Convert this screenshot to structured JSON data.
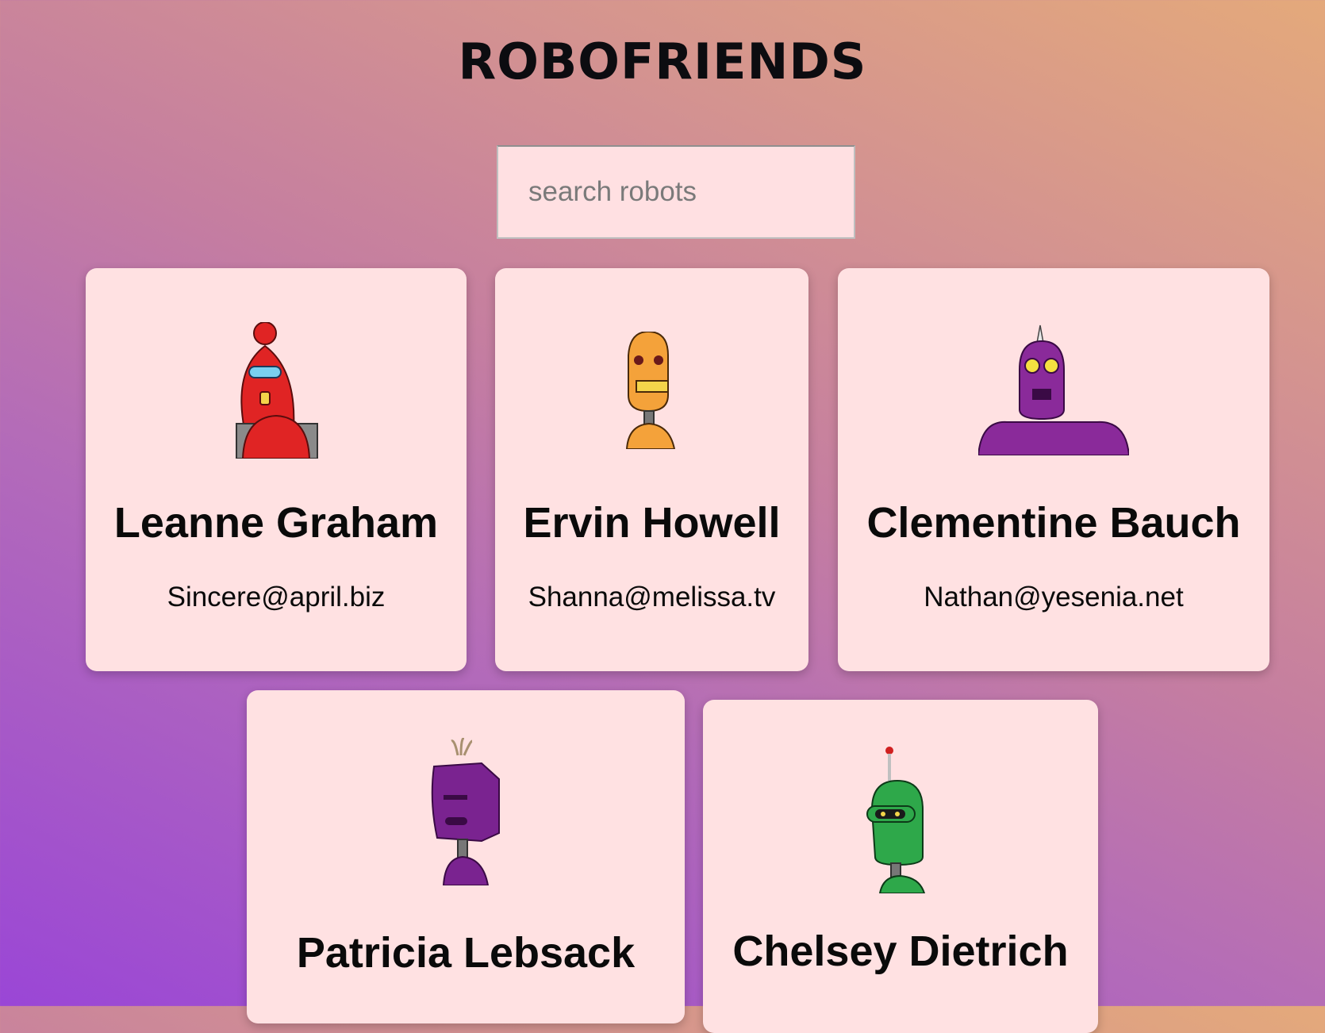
{
  "header": {
    "title": "ROBOFRIENDS"
  },
  "search": {
    "placeholder": "search robots",
    "value": ""
  },
  "robots": [
    {
      "name": "Leanne Graham",
      "email": "Sincere@april.biz",
      "icon": "red-robot-icon",
      "color": "#e02424"
    },
    {
      "name": "Ervin Howell",
      "email": "Shanna@melissa.tv",
      "icon": "orange-robot-icon",
      "color": "#f4a23a"
    },
    {
      "name": "Clementine Bauch",
      "email": "Nathan@yesenia.net",
      "icon": "purple-robot-icon",
      "color": "#8a2a9a"
    },
    {
      "name": "Patricia Lebsack",
      "email": "",
      "icon": "purple-block-robot-icon",
      "color": "#7a2390"
    },
    {
      "name": "Chelsey Dietrich",
      "email": "",
      "icon": "green-robot-icon",
      "color": "#2ea84a"
    }
  ]
}
